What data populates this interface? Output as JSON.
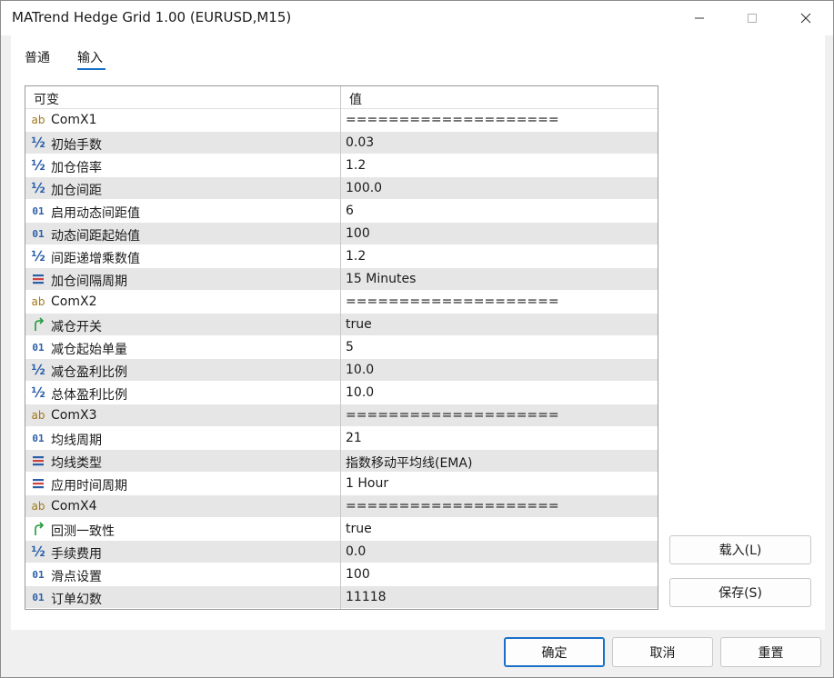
{
  "window": {
    "title": "MATrend Hedge Grid 1.00 (EURUSD,M15)"
  },
  "tabs": [
    {
      "label": "普通"
    },
    {
      "label": "输入"
    }
  ],
  "grid": {
    "columns": {
      "name": "可变",
      "value": "值"
    },
    "rows": [
      {
        "icon": "ab",
        "name": "ComX1",
        "value": "===================="
      },
      {
        "icon": "half",
        "name": "初始手数",
        "value": "0.03"
      },
      {
        "icon": "half",
        "name": "加仓倍率",
        "value": "1.2"
      },
      {
        "icon": "half",
        "name": "加仓间距",
        "value": "100.0"
      },
      {
        "icon": "int",
        "name": "启用动态间距值",
        "value": "6"
      },
      {
        "icon": "int",
        "name": "动态间距起始值",
        "value": "100"
      },
      {
        "icon": "half",
        "name": "间距递增乘数值",
        "value": "1.2"
      },
      {
        "icon": "enum",
        "name": "加仓间隔周期",
        "value": "15 Minutes"
      },
      {
        "icon": "ab",
        "name": "ComX2",
        "value": "===================="
      },
      {
        "icon": "bool",
        "name": "减仓开关",
        "value": "true"
      },
      {
        "icon": "int",
        "name": "减仓起始单量",
        "value": "5"
      },
      {
        "icon": "half",
        "name": "减仓盈利比例",
        "value": "10.0"
      },
      {
        "icon": "half",
        "name": "总体盈利比例",
        "value": "10.0"
      },
      {
        "icon": "ab",
        "name": "ComX3",
        "value": "===================="
      },
      {
        "icon": "int",
        "name": "均线周期",
        "value": "21"
      },
      {
        "icon": "enum",
        "name": "均线类型",
        "value": "指数移动平均线(EMA)"
      },
      {
        "icon": "enum",
        "name": "应用时间周期",
        "value": "1 Hour"
      },
      {
        "icon": "ab",
        "name": "ComX4",
        "value": "===================="
      },
      {
        "icon": "bool",
        "name": "回测一致性",
        "value": "true"
      },
      {
        "icon": "half",
        "name": "手续费用",
        "value": "0.0"
      },
      {
        "icon": "int",
        "name": "滑点设置",
        "value": "100"
      },
      {
        "icon": "int",
        "name": "订单幻数",
        "value": "11118"
      }
    ]
  },
  "buttons": {
    "load": "载入(L)",
    "save": "保存(S)",
    "ok": "确定",
    "cancel": "取消",
    "reset": "重置"
  },
  "colors": {
    "accent": "#1a70c8",
    "row_alt": "#e6e6e6",
    "icon_string": "#a07818",
    "icon_number": "#2a5ea8",
    "icon_bool": "#1f9a3a",
    "icon_enum": "#2a5ea8"
  }
}
